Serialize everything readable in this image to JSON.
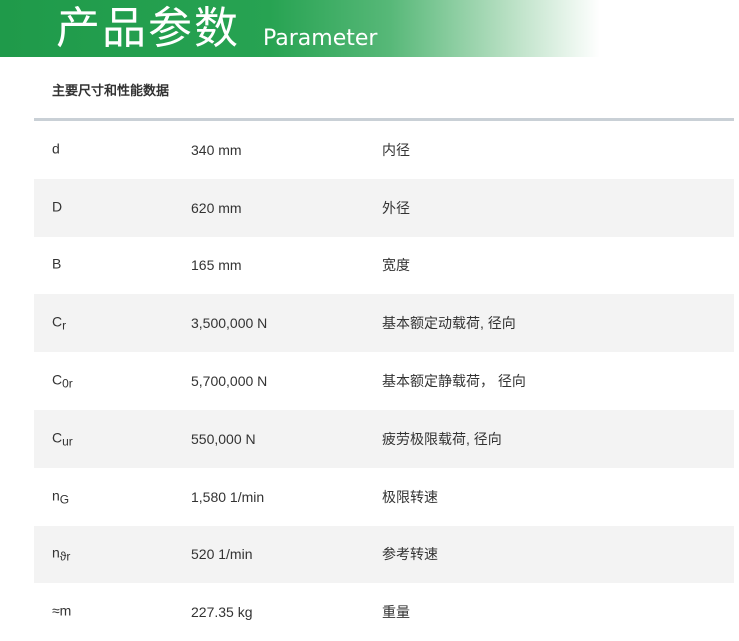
{
  "banner": {
    "title": "产品参数",
    "subtitle": "Parameter"
  },
  "section_title": "主要尺寸和性能数据",
  "rows": [
    {
      "symbol": "d",
      "sub": "",
      "value": "340 mm",
      "desc": "内径"
    },
    {
      "symbol": "D",
      "sub": "",
      "value": "620 mm",
      "desc": "外径"
    },
    {
      "symbol": "B",
      "sub": "",
      "value": "165 mm",
      "desc": "宽度"
    },
    {
      "symbol": "C",
      "sub": "r",
      "value": "3,500,000 N",
      "desc": "基本额定动载荷, 径向"
    },
    {
      "symbol": "C",
      "sub": "0r",
      "value": "5,700,000 N",
      "desc": "基本额定静载荷， 径向"
    },
    {
      "symbol": "C",
      "sub": "ur",
      "value": "550,000 N",
      "desc": "疲劳极限载荷, 径向"
    },
    {
      "symbol": "n",
      "sub": "G",
      "value": "1,580 1/min",
      "desc": "极限转速"
    },
    {
      "symbol": "n",
      "sub": "ϑr",
      "value": "520 1/min",
      "desc": "参考转速"
    },
    {
      "symbol": "≈m",
      "sub": "",
      "value": "227.35 kg",
      "desc": "重量"
    }
  ]
}
